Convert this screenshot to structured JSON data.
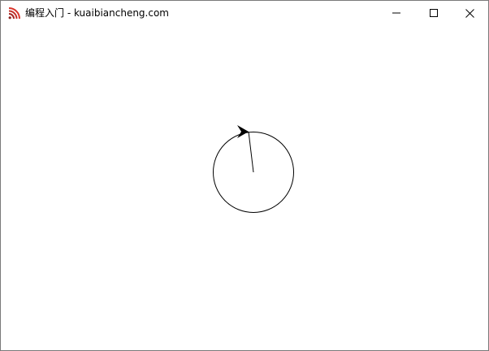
{
  "window": {
    "title": "编程入门 - kuaibiancheng.com",
    "app_icon": "feed-waves-icon",
    "accent_color": "#d9342b",
    "controls": [
      "minimize-icon",
      "maximize-icon",
      "close-icon"
    ]
  },
  "canvas": {
    "background": "#ffffff",
    "shapes": [
      "turtle-circle",
      "turtle-radius-line",
      "turtle-cursor"
    ]
  }
}
